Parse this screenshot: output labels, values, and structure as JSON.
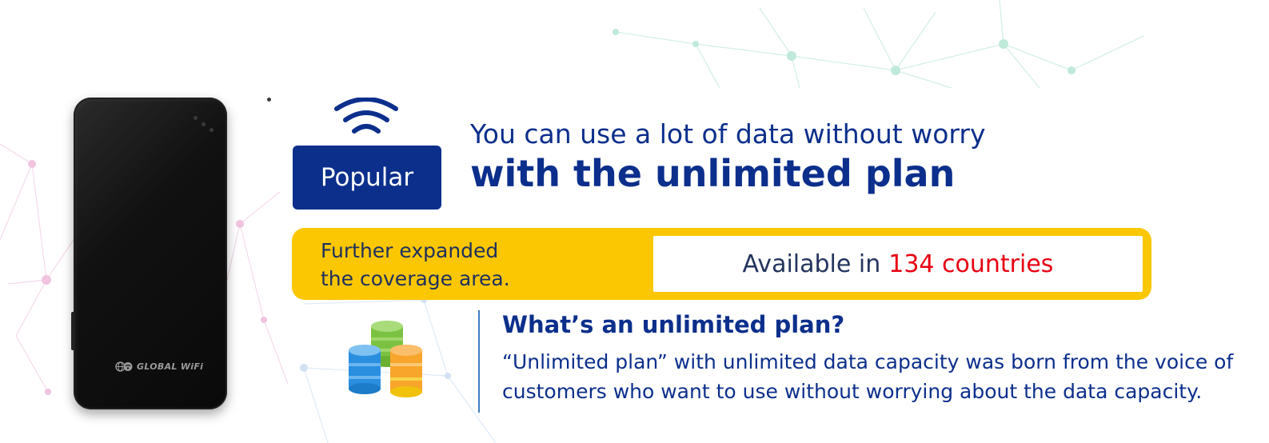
{
  "device": {
    "brand_label": "GLOBAL WiFi",
    "brand_icon": "globe-wifi-logo-icon"
  },
  "icons": {
    "wifi": "wifi-signal-icon",
    "database": "stacked-database-icon"
  },
  "badge": {
    "label": "Popular"
  },
  "headline": {
    "line1": "You can use a lot of data without worry",
    "line2": "with the unlimited plan"
  },
  "coverage": {
    "label_line1": "Further expanded",
    "label_line2": "the coverage area.",
    "available_prefix": "Available in",
    "available_highlight": "134 countries"
  },
  "info": {
    "title": "What’s an unlimited plan?",
    "body": "“Unlimited plan” with unlimited data capacity was born from the voice of customers who want to use without worrying about the data capacity."
  },
  "colors": {
    "brand_blue": "#0c2f8c",
    "accent_yellow": "#fbc703",
    "highlight_red": "#e60012",
    "text_navy": "#23345e"
  }
}
